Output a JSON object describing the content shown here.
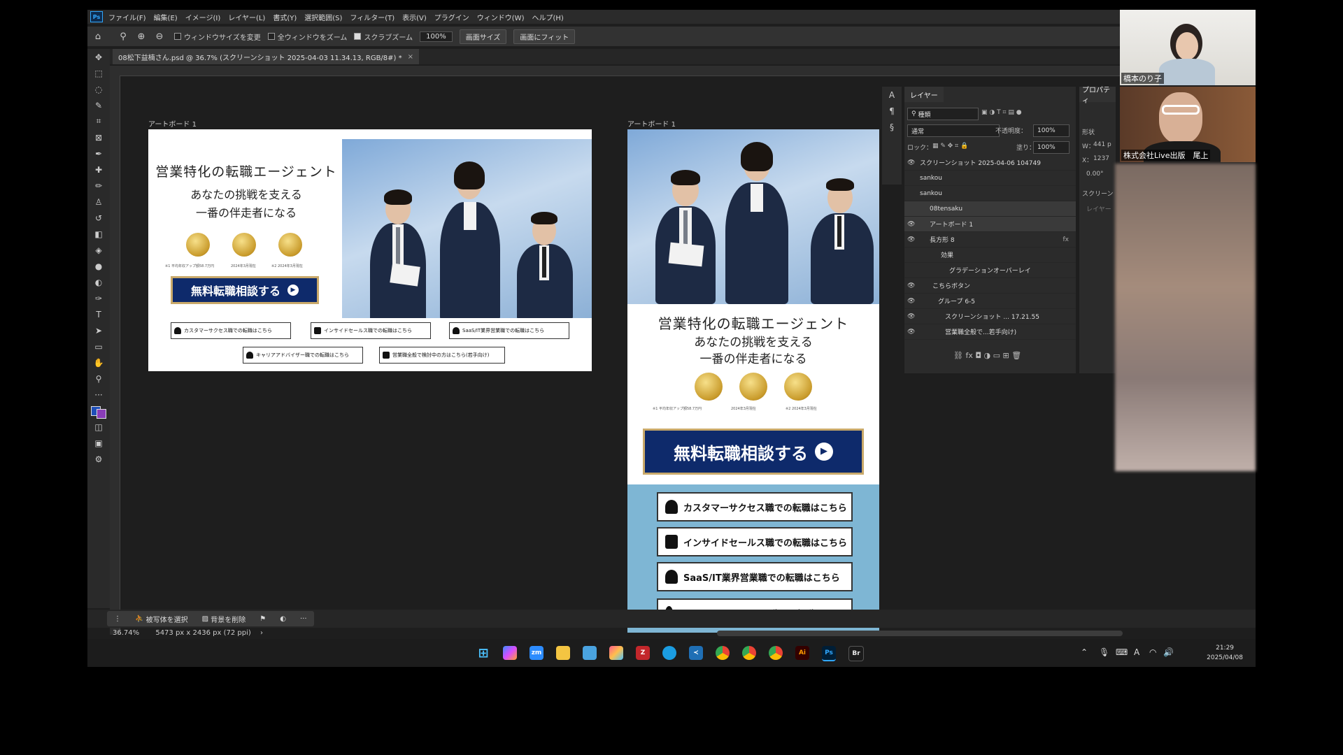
{
  "menu": {
    "items": [
      "ファイル(F)",
      "編集(E)",
      "イメージ(I)",
      "レイヤー(L)",
      "書式(Y)",
      "選択範囲(S)",
      "フィルター(T)",
      "表示(V)",
      "プラグイン",
      "ウィンドウ(W)",
      "ヘルプ(H)"
    ]
  },
  "options": {
    "resize_window": "ウィンドウサイズを変更",
    "zoom_all": "全ウィンドウをズーム",
    "scrubby_zoom": "スクラブズーム",
    "zoom_value": "100%",
    "screen_size": "画面サイズ",
    "fit_screen": "画面にフィット"
  },
  "document_tab": {
    "title": "08松下益楠さん.psd @ 36.7% (スクリーンショット 2025-04-03 11.34.13, RGB/8#) *",
    "close": "×"
  },
  "artboard1": {
    "label": "アートボード 1",
    "headline1": "営業特化の転職エージェント",
    "headline2": "あなたの挑戦を支える",
    "headline3": "一番の伴走者になる",
    "note1": "※1 平均年収アップ額58.7万円",
    "note2": "2024年3月現在",
    "note3": "※2 2024年3月現在",
    "cta": "無料転職相談する",
    "links": [
      "カスタマーサクセス職での転職はこちら",
      "インサイドセールス職での転職はこちら",
      "SaaS/IT業界営業職での転職はこちら",
      "キャリアアドバイザー職での転職はこちら",
      "営業職全般で検討中の方はこちら(若手向け)"
    ]
  },
  "artboard2": {
    "label": "アートボード 1",
    "headline1": "営業特化の転職エージェント",
    "headline2": "あなたの挑戦を支える",
    "headline3": "一番の伴走者になる",
    "note1": "※1 平均年収アップ額58.7万円",
    "note2": "2024年3月現在",
    "note3": "※2 2024年3月現在",
    "cta": "無料転職相談する",
    "links": [
      "カスタマーサクセス職での転職はこちら",
      "インサイドセールス職での転職はこちら",
      "SaaS/IT業界営業職での転職はこちら",
      "キャリアアドバイザー職での転職はこちら"
    ]
  },
  "layers_panel": {
    "tab": "レイヤー",
    "filter": "種類",
    "blend_mode": "通常",
    "opacity_label": "不透明度：",
    "opacity_value": "100%",
    "lock_label": "ロック：",
    "fill_label": "塗り：",
    "fill_value": "100%",
    "layers": [
      "スクリーンショット 2025-04-06 104749",
      "sankou",
      "sankou",
      "08tensaku",
      "アートボード 1",
      "長方形 8",
      "効果",
      "グラデーションオーバーレイ",
      "こちらボタン",
      "グループ 6-5",
      "スクリーンショット ... 17.21.55",
      "営業職全般で...若手向け)"
    ]
  },
  "properties_panel": {
    "tab": "プロパティ",
    "shape": "形状",
    "w": "W：",
    "w_val": "441 p",
    "x": "X：",
    "x_val": "1237",
    "angle": "0.00°",
    "screen": "スクリーン",
    "layer": "レイヤー"
  },
  "context_bar": {
    "select_subject": "被写体を選択",
    "remove_bg": "背景を削除",
    "more": "···"
  },
  "status": {
    "zoom": "36.74%",
    "size": "5473 px x 2436 px (72 ppi)"
  },
  "taskbar": {
    "time": "21:29",
    "date": "2025/04/08",
    "icons": [
      "windows-start",
      "copilot",
      "zoom",
      "file-explorer",
      "notepad",
      "photos",
      "filezilla",
      "edge",
      "vscode",
      "chrome",
      "chrome-2",
      "chrome-3",
      "illustrator",
      "photoshop",
      "bridge"
    ],
    "labels": {
      "zoom": "zm",
      "illustrator": "Ai",
      "photoshop": "Ps",
      "bridge": "Br"
    }
  },
  "video": {
    "participant1": "橋本のり子",
    "participant2": "株式会社Live出版　尾上"
  },
  "colors": {
    "cta_navy": "#0e2a6b",
    "gold": "#c9a96a",
    "section_blue": "#7eb6d4",
    "ps_dark": "#1e1e1e"
  }
}
